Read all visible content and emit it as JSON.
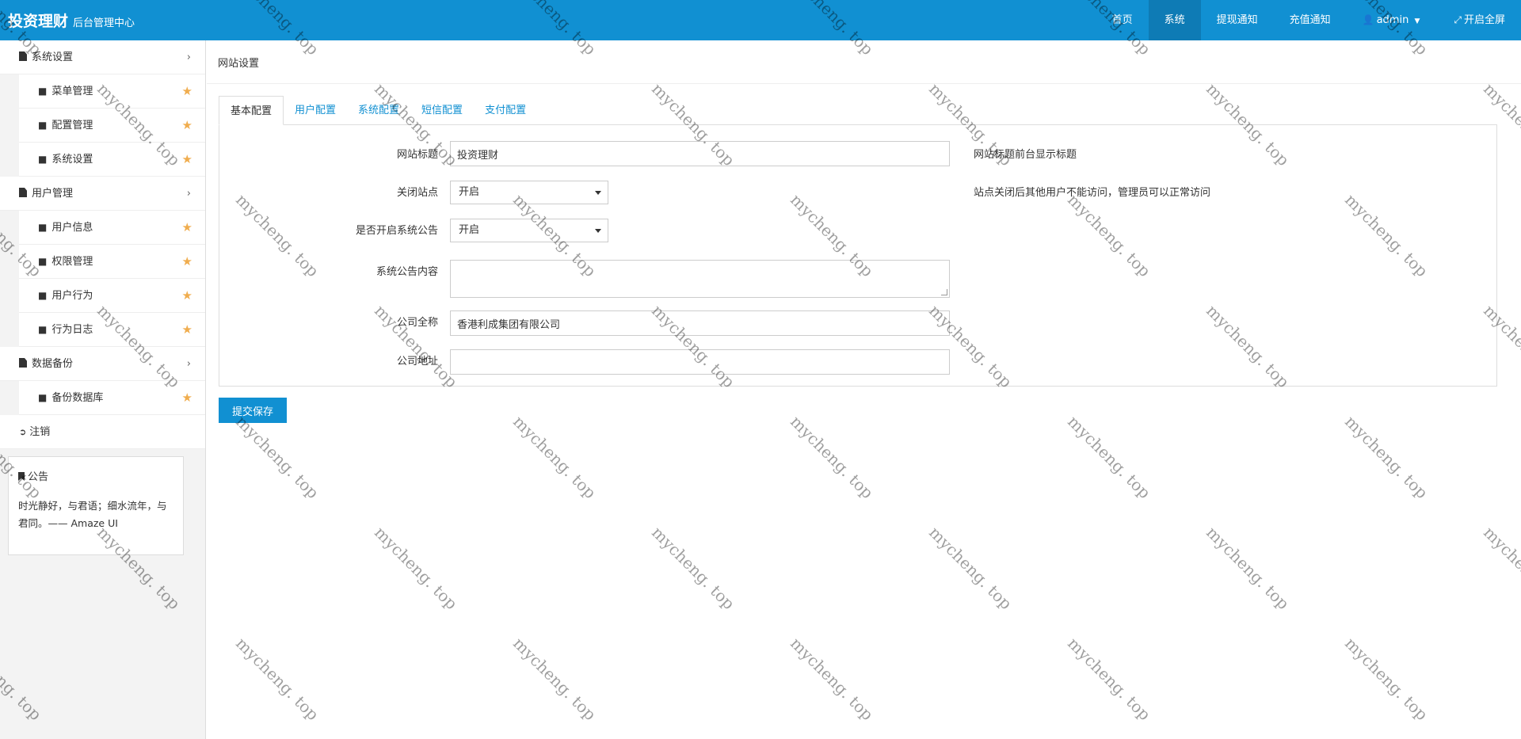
{
  "header": {
    "brand_title": "投资理财",
    "brand_subtitle": "后台管理中心",
    "nav": [
      {
        "label": "首页",
        "active": false
      },
      {
        "label": "系统",
        "active": true
      },
      {
        "label": "提现通知",
        "active": false
      },
      {
        "label": "充值通知",
        "active": false
      },
      {
        "label": "admin",
        "icon": "user-icon",
        "has_dropdown": true
      },
      {
        "label": "开启全屏",
        "icon": "fullscreen-icon"
      }
    ],
    "color": "#1190d2"
  },
  "sidebar": {
    "groups": [
      {
        "label": "系统设置",
        "icon": "file-icon",
        "items": [
          "菜单管理",
          "配置管理",
          "系统设置"
        ]
      },
      {
        "label": "用户管理",
        "icon": "file-icon",
        "items": [
          "用户信息",
          "权限管理",
          "用户行为",
          "行为日志"
        ]
      },
      {
        "label": "数据备份",
        "icon": "file-icon",
        "items": [
          "备份数据库"
        ]
      }
    ],
    "logout_label": "注销",
    "notice": {
      "title": "公告",
      "body": "时光静好，与君语；细水流年，与君同。—— Amaze UI"
    }
  },
  "main": {
    "page_title": "网站设置",
    "tabs": [
      "基本配置",
      "用户配置",
      "系统配置",
      "短信配置",
      "支付配置"
    ],
    "active_tab": "基本配置",
    "form": {
      "site_title": {
        "label": "网站标题",
        "value": "投资理财",
        "help": "网站标题前台显示标题"
      },
      "close_site": {
        "label": "关闭站点",
        "value": "开启",
        "help": "站点关闭后其他用户不能访问，管理员可以正常访问"
      },
      "enable_notice": {
        "label": "是否开启系统公告",
        "value": "开启"
      },
      "notice_content": {
        "label": "系统公告内容",
        "value": ""
      },
      "company_name": {
        "label": "公司全称",
        "value": "香港利成集团有限公司"
      },
      "company_address": {
        "label": "公司地址",
        "value": ""
      }
    },
    "submit_label": "提交保存"
  },
  "watermark": "mycheng. top"
}
